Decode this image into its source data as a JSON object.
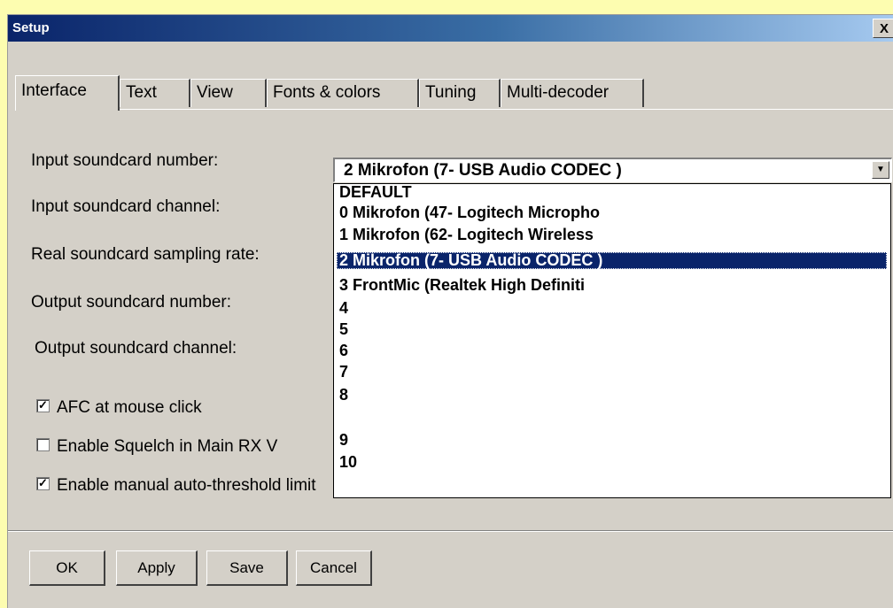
{
  "window": {
    "title": "Setup",
    "close_label": "X"
  },
  "tabs": [
    {
      "label": "Interface",
      "active": true
    },
    {
      "label": "Text",
      "active": false
    },
    {
      "label": "View",
      "active": false
    },
    {
      "label": "Fonts & colors",
      "active": false
    },
    {
      "label": "Tuning",
      "active": false
    },
    {
      "label": "Multi-decoder",
      "active": false
    }
  ],
  "fields": {
    "input_soundcard_number": "Input soundcard number:",
    "input_soundcard_channel": "Input soundcard channel:",
    "real_sampling_rate": "Real soundcard sampling rate:",
    "output_soundcard_number": "Output soundcard number:",
    "output_soundcard_channel": "Output soundcard channel:"
  },
  "checkboxes": [
    {
      "label": "AFC at mouse click",
      "checked": true
    },
    {
      "label": "Enable Squelch in Main RX V",
      "checked": false
    },
    {
      "label": "Enable manual auto-threshold limit",
      "checked": true
    }
  ],
  "combo": {
    "selected": "2  Mikrofon (7- USB Audio CODEC )",
    "options": [
      "DEFAULT",
      "0  Mikrofon (47- Logitech Micropho",
      "1  Mikrofon (62- Logitech Wireless",
      "2  Mikrofon (7- USB Audio CODEC )",
      "3  FrontMic (Realtek High Definiti",
      "4",
      "5",
      "6",
      "7",
      "8",
      "9",
      "10"
    ],
    "highlighted_index": 3
  },
  "buttons": {
    "ok": "OK",
    "apply": "Apply",
    "save": "Save",
    "cancel": "Cancel"
  },
  "icons": {
    "dropdown_arrow": "chevron-down-icon",
    "checkmark": "checkmark-icon",
    "close": "close-icon"
  },
  "colors": {
    "titlebar_start": "#0a246a",
    "dialog_bg": "#d4d0c8",
    "selection": "#0a246a"
  }
}
